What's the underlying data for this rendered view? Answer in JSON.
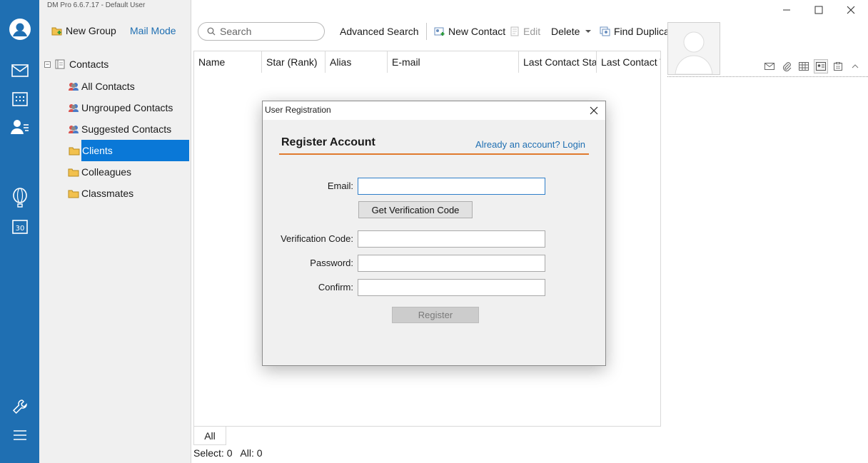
{
  "app": {
    "title": "DM Pro 6.6.7.17  -  Default User"
  },
  "rail": {
    "items": [
      "profile-icon",
      "mail-icon",
      "calendar-icon",
      "contacts-icon",
      "balloon-icon",
      "calendar-30-icon",
      "wrench-icon",
      "menu-icon"
    ]
  },
  "panel": {
    "new_group": "New Group",
    "mail_mode": "Mail Mode",
    "tree_root": "Contacts",
    "tree_toggle": "−",
    "items": [
      {
        "label": "All Contacts",
        "icon": "contact-group-icon"
      },
      {
        "label": "Ungrouped Contacts",
        "icon": "contact-group-icon"
      },
      {
        "label": "Suggested Contacts",
        "icon": "contact-group-icon"
      },
      {
        "label": "Clients",
        "icon": "folder-icon"
      },
      {
        "label": "Colleagues",
        "icon": "folder-icon"
      },
      {
        "label": "Classmates",
        "icon": "folder-icon"
      }
    ],
    "selected": "Clients"
  },
  "toolbar": {
    "search_placeholder": "Search",
    "advanced_search": "Advanced Search",
    "new_contact": "New Contact",
    "edit": "Edit",
    "delete": "Delete",
    "find_duplicates": "Find Duplica"
  },
  "grid": {
    "columns": [
      "Name",
      "Star (Rank)",
      "Alias",
      "E-mail",
      "Last Contact Stat",
      "Last Contact T"
    ],
    "rows": []
  },
  "tabs": {
    "all": "All"
  },
  "status": {
    "select_label": "Select:",
    "select_count": "0",
    "all_label": "All:",
    "all_count": "0"
  },
  "dialog": {
    "title": "User Registration",
    "heading": "Register Account",
    "login_link": "Already an account? Login",
    "email_label": "Email:",
    "email_value": "",
    "get_code": "Get Verification Code",
    "code_label": "Verification Code:",
    "password_label": "Password:",
    "confirm_label": "Confirm:",
    "register": "Register"
  },
  "colors": {
    "rail": "#1f6fb2",
    "selection": "#0a78d7",
    "accent_line": "#e07a2e",
    "link": "#1f6fb2"
  }
}
